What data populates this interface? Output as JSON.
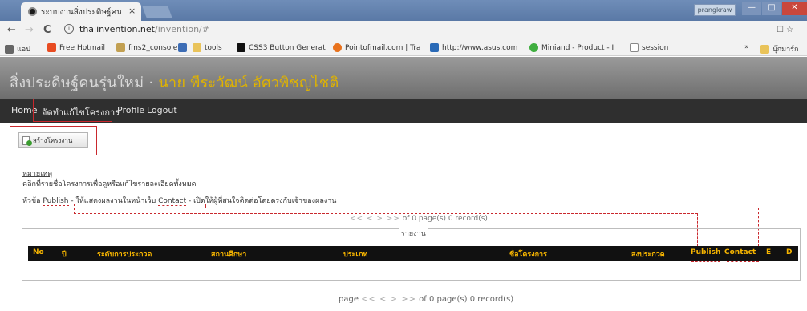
{
  "browser": {
    "tab_title": "ระบบงานสิ่งประดิษฐ์คนรุ่นใ",
    "tab_close": "×",
    "window_user": "prangkraw",
    "controls": {
      "min": "—",
      "max": "□",
      "close": "✕"
    },
    "back": "←",
    "forward": "→",
    "reload": "C",
    "info_icon": "i",
    "url_host": "thaiinvention.net",
    "url_path": "/invention/#",
    "right_icons": "☐ ☆",
    "bookmarks": [
      {
        "label": "แอป",
        "color": "#666666"
      },
      {
        "label": "Free Hotmail",
        "color": "#e84c22"
      },
      {
        "label": "fms2_console",
        "color": "#c2a052"
      },
      {
        "label": "",
        "color": "#3d6db5"
      },
      {
        "label": "tools",
        "color": "#e9c35a"
      },
      {
        "label": "CSS3 Button Generat",
        "color": "#111111"
      },
      {
        "label": "Pointofmail.com | Tra",
        "color": "#e8721d"
      },
      {
        "label": "http://www.asus.com",
        "color": "#2a6ab7"
      },
      {
        "label": "Miniand - Product - I",
        "color": "#3fae3f"
      },
      {
        "label": "session",
        "color": "#ffffff"
      }
    ],
    "bookmarks_more": "»",
    "bookmarks_other": "บุ๊กมาร์ก"
  },
  "site": {
    "title_prefix": "สิ่งประดิษฐ์คนรุ่นใหม่ · ",
    "title_user": "นาย พีระวัฒน์ อัศวพิชญไชติ",
    "nav": [
      "Home",
      "จัดทำแก้ไขโครงการ",
      "Profile",
      "Logout"
    ]
  },
  "main": {
    "create_button": "สร้างโครงงาน",
    "note_heading": "หมายเหตุ",
    "note_line1": "คลิกที่รายชื่อโครงการเพื่อดูหรือแก้ไขรายละเอียดทั้งหมด",
    "note2_prefix": "หัวข้อ ",
    "note2_publish": "Publish",
    "note2_mid": " - ให้แสดงผลงานในหน้าเว็บ ",
    "note2_contact": "Contact",
    "note2_suffix": " - เปิดให้ผู้ที่สนใจติดต่อโดยตรงกับเจ้าของผลงาน",
    "pager_top_arrows": "<< < > >>",
    "pager_top_text": "of 0 page(s) 0 record(s)",
    "fieldset_legend": "รายงาน",
    "columns": [
      "No",
      "ปี",
      "ระดับการประกวด",
      "สถานศึกษา",
      "ประเภท",
      "ชื่อโครงการ",
      "ส่งประกวด",
      "Publish",
      "Contact",
      "E",
      "D"
    ],
    "pager_bottom_label": "page",
    "pager_bottom_arrows": "<< < > >>",
    "pager_bottom_text": "of 0 page(s) 0 record(s)"
  },
  "colors": {
    "accent_red": "#c9282d",
    "header_gold": "#f7b500",
    "user_gold": "#e0b300"
  }
}
